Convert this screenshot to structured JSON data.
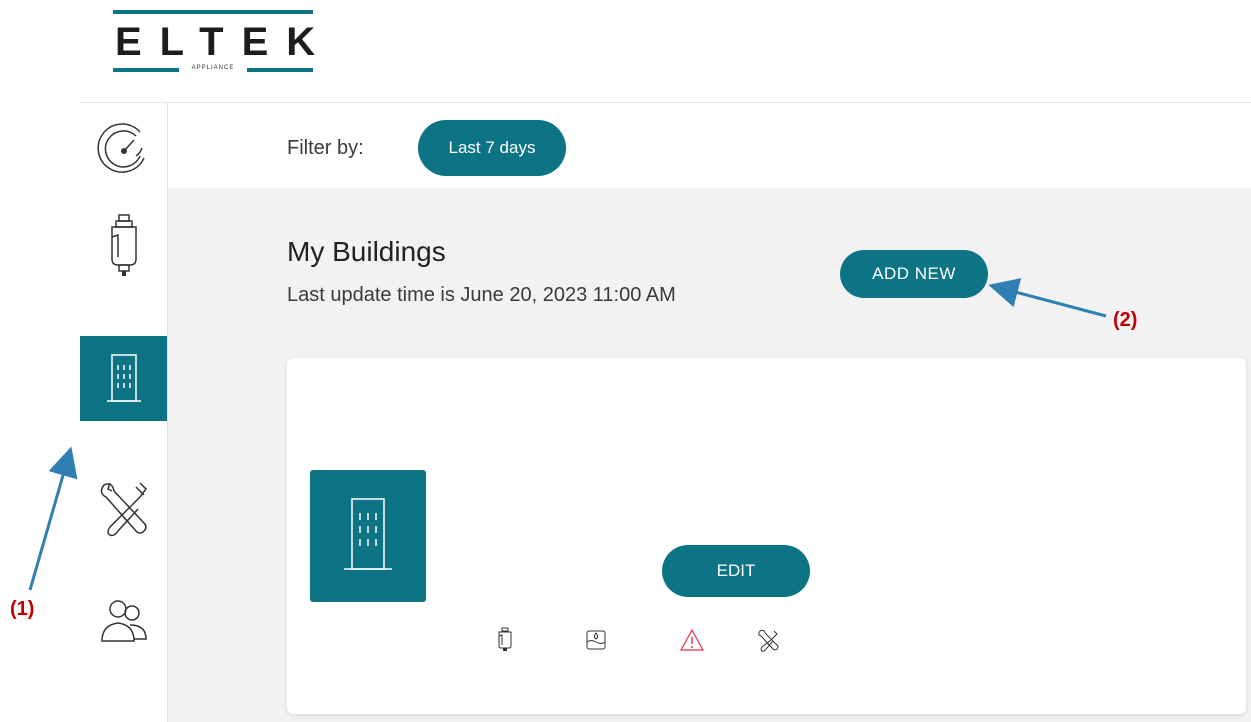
{
  "brand": {
    "name": "ELTEK",
    "tagline": "APPLIANCE",
    "accent": "#0d7485"
  },
  "sidebar": {
    "items": [
      {
        "icon": "dashboard-gauge-icon",
        "active": false
      },
      {
        "icon": "device-icon",
        "active": false
      },
      {
        "icon": "building-icon",
        "active": true
      },
      {
        "icon": "tools-icon",
        "active": false
      },
      {
        "icon": "users-icon",
        "active": false
      }
    ]
  },
  "filter": {
    "label": "Filter by:",
    "value": "Last 7 days"
  },
  "section": {
    "title": "My Buildings",
    "subtitle": "Last update time is June 20, 2023 11:00 AM",
    "add_label": "ADD NEW"
  },
  "card": {
    "icon": "building-icon",
    "edit_label": "EDIT",
    "status_icons": [
      "device-icon",
      "water-tank-icon",
      "warning-icon",
      "tools-icon"
    ],
    "warning_color": "#e3324a"
  },
  "annotations": {
    "one": "(1)",
    "two": "(2)",
    "color": "#c00000"
  }
}
